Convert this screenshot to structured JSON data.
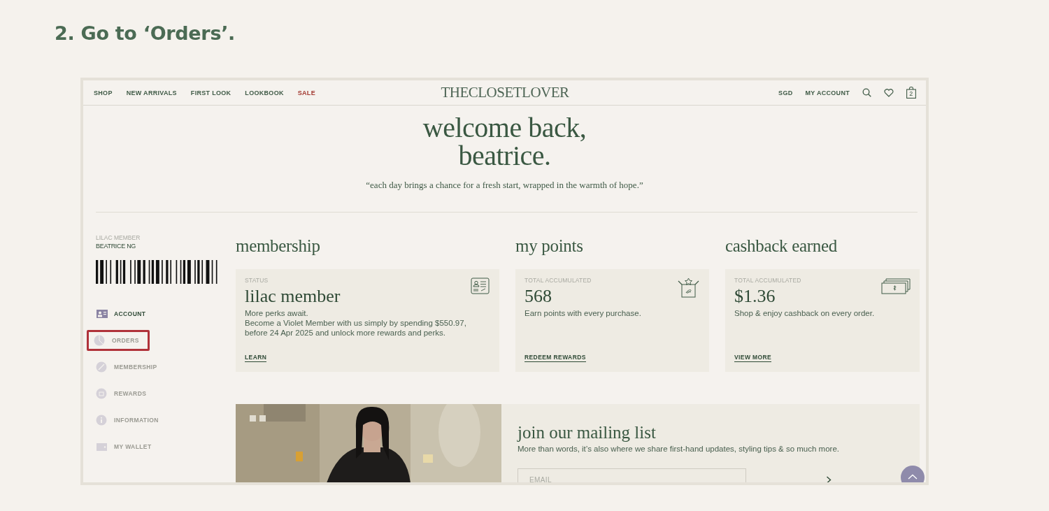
{
  "step_title": "2. Go to ‘Orders’.",
  "nav": {
    "links": [
      {
        "label": "SHOP",
        "kind": "normal"
      },
      {
        "label": "NEW ARRIVALS",
        "kind": "normal"
      },
      {
        "label": "FIRST LOOK",
        "kind": "normal"
      },
      {
        "label": "LOOKBOOK",
        "kind": "normal"
      },
      {
        "label": "SALE",
        "kind": "sale"
      }
    ],
    "logo": "THECLOSETLOVER",
    "currency": "SGD",
    "account": "MY ACCOUNT",
    "cart_count": "2"
  },
  "welcome": {
    "lines": [
      "welcome back,",
      "beatrice."
    ],
    "quote": "“each day brings a chance for a fresh start, wrapped in the warmth of hope.”"
  },
  "sidebar": {
    "tier": "LILAC MEMBER",
    "name": "BEATRICE NG",
    "items": [
      {
        "label": "ACCOUNT",
        "kind": "account",
        "selected": true,
        "highlighted": false
      },
      {
        "label": "ORDERS",
        "kind": "orders",
        "selected": false,
        "highlighted": true
      },
      {
        "label": "MEMBERSHIP",
        "kind": "membership",
        "selected": false,
        "highlighted": false
      },
      {
        "label": "REWARDS",
        "kind": "rewards",
        "selected": false,
        "highlighted": false
      },
      {
        "label": "INFORMATION",
        "kind": "information",
        "selected": false,
        "highlighted": false
      },
      {
        "label": "MY WALLET",
        "kind": "wallet",
        "selected": false,
        "highlighted": false
      }
    ]
  },
  "cards": [
    {
      "kind": "membership",
      "title": "membership",
      "label": "STATUS",
      "value": "lilac member",
      "lines": [
        "More perks await.",
        "Become a Violet Member with us simply by spending $550.97, before 24 Apr 2025 and unlock more rewards and perks."
      ],
      "link": "LEARN"
    },
    {
      "kind": "points",
      "title": "my points",
      "label": "TOTAL ACCUMULATED",
      "value": "568",
      "lines": [
        "Earn points with every purchase."
      ],
      "link": "REDEEM REWARDS"
    },
    {
      "kind": "cashback",
      "title": "cashback earned",
      "label": "TOTAL ACCUMULATED",
      "value": "$1.36",
      "lines": [
        "Shop & enjoy cashback on every order."
      ],
      "link": "VIEW MORE"
    }
  ],
  "mailing": {
    "title": "join our mailing list",
    "text": "More than words, it’s also where we share first-hand updates, styling tips & so much more.",
    "placeholder": "EMAIL"
  }
}
